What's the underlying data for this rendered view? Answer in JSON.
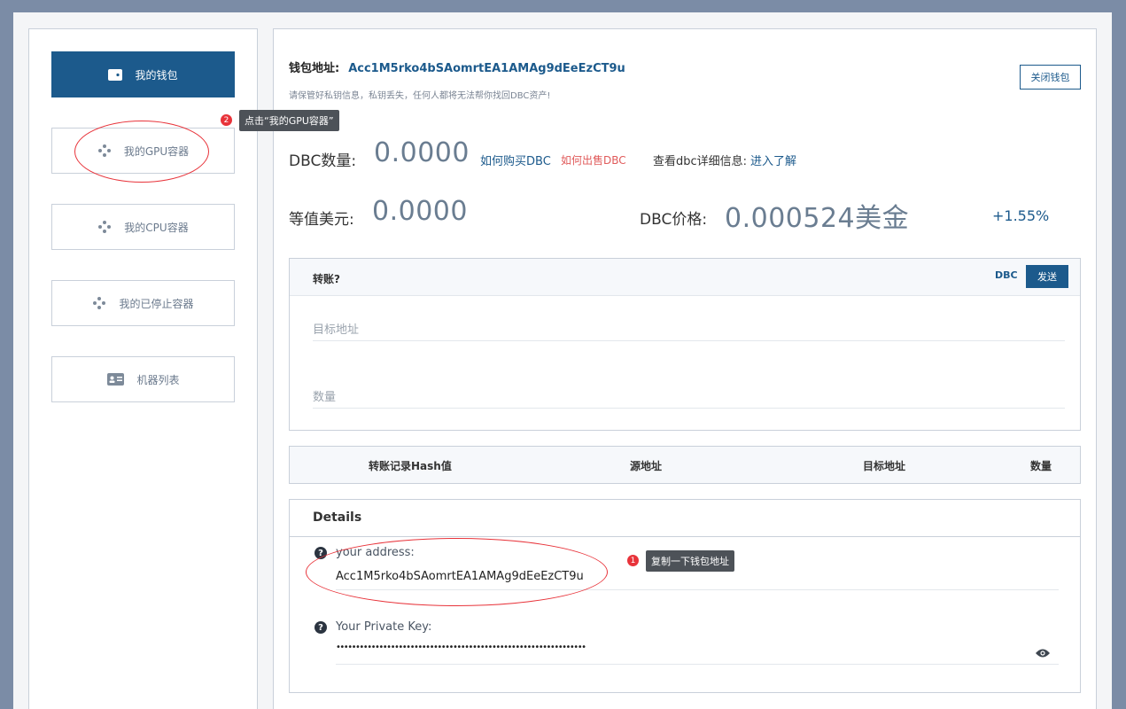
{
  "sidebar": {
    "items": [
      {
        "label": "我的钱包",
        "icon": "wallet-icon"
      },
      {
        "label": "我的GPU容器",
        "icon": "network-icon"
      },
      {
        "label": "我的CPU容器",
        "icon": "network-icon"
      },
      {
        "label": "我的已停止容器",
        "icon": "network-icon"
      },
      {
        "label": "机器列表",
        "icon": "id-card-icon"
      }
    ]
  },
  "wallet": {
    "address_label": "钱包地址:",
    "address": "Acc1M5rko4bSAomrtEA1AMAg9dEeEzCT9u",
    "warning": "请保管好私钥信息，私钥丢失，任何人都将无法帮你找回DBC资产!",
    "close_label": "关闭钱包"
  },
  "stats": {
    "dbc_label": "DBC数量:",
    "dbc_value": "0.0000",
    "buy_link": "如何购买DBC",
    "sell_link": "如何出售DBC",
    "detail_prefix": "查看dbc详细信息:",
    "detail_link": "进入了解",
    "usd_label": "等值美元:",
    "usd_value": "0.0000",
    "price_label": "DBC价格:",
    "price_value": "0.000524美金",
    "change": "+1.55%"
  },
  "transfer": {
    "title": "转账?",
    "currency": "DBC",
    "send_label": "发送",
    "target_placeholder": "目标地址",
    "amount_placeholder": "数量"
  },
  "history": {
    "columns": [
      "转账记录Hash值",
      "源地址",
      "目标地址",
      "数量"
    ]
  },
  "details": {
    "title": "Details",
    "address_label": "your address:",
    "address_value": "Acc1M5rko4bSAomrtEA1AMAg9dEeEzCT9u",
    "key_label": "Your Private Key:",
    "key_value": "••••••••••••••••••••••••••••••••••••••••••••••••••••••••••••••••"
  },
  "annotations": {
    "step1_num": "1",
    "step1_text": "复制一下钱包地址",
    "step2_num": "2",
    "step2_text": "点击“我的GPU容器”"
  },
  "colors": {
    "accent": "#1c5a8c",
    "annotation": "#e8333a"
  }
}
